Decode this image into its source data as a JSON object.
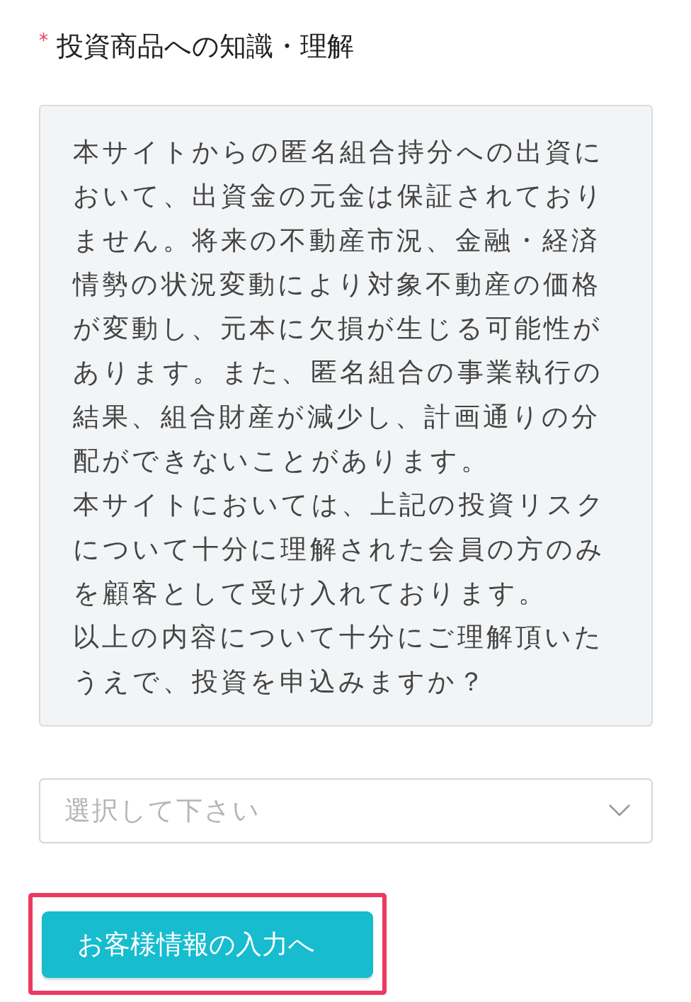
{
  "question": {
    "required_mark": "*",
    "label": "投資商品への知識・理解"
  },
  "notice": {
    "paragraphs": [
      "本サイトからの匿名組合持分への出資において、出資金の元金は保証されておりません。将来の不動産市況、金融・経済情勢の状況変動により対象不動産の価格が変動し、元本に欠損が生じる可能性があります。また、匿名組合の事業執行の結果、組合財産が減少し、計画通りの分配ができないことがあります。",
      "本サイトにおいては、上記の投資リスクについて十分に理解された会員の方のみを顧客として受け入れております。",
      "以上の内容について十分にご理解頂いたうえで、投資を申込みますか？"
    ]
  },
  "select": {
    "placeholder": "選択して下さい"
  },
  "button": {
    "label": "お客様情報の入力へ",
    "highlighted": true
  }
}
